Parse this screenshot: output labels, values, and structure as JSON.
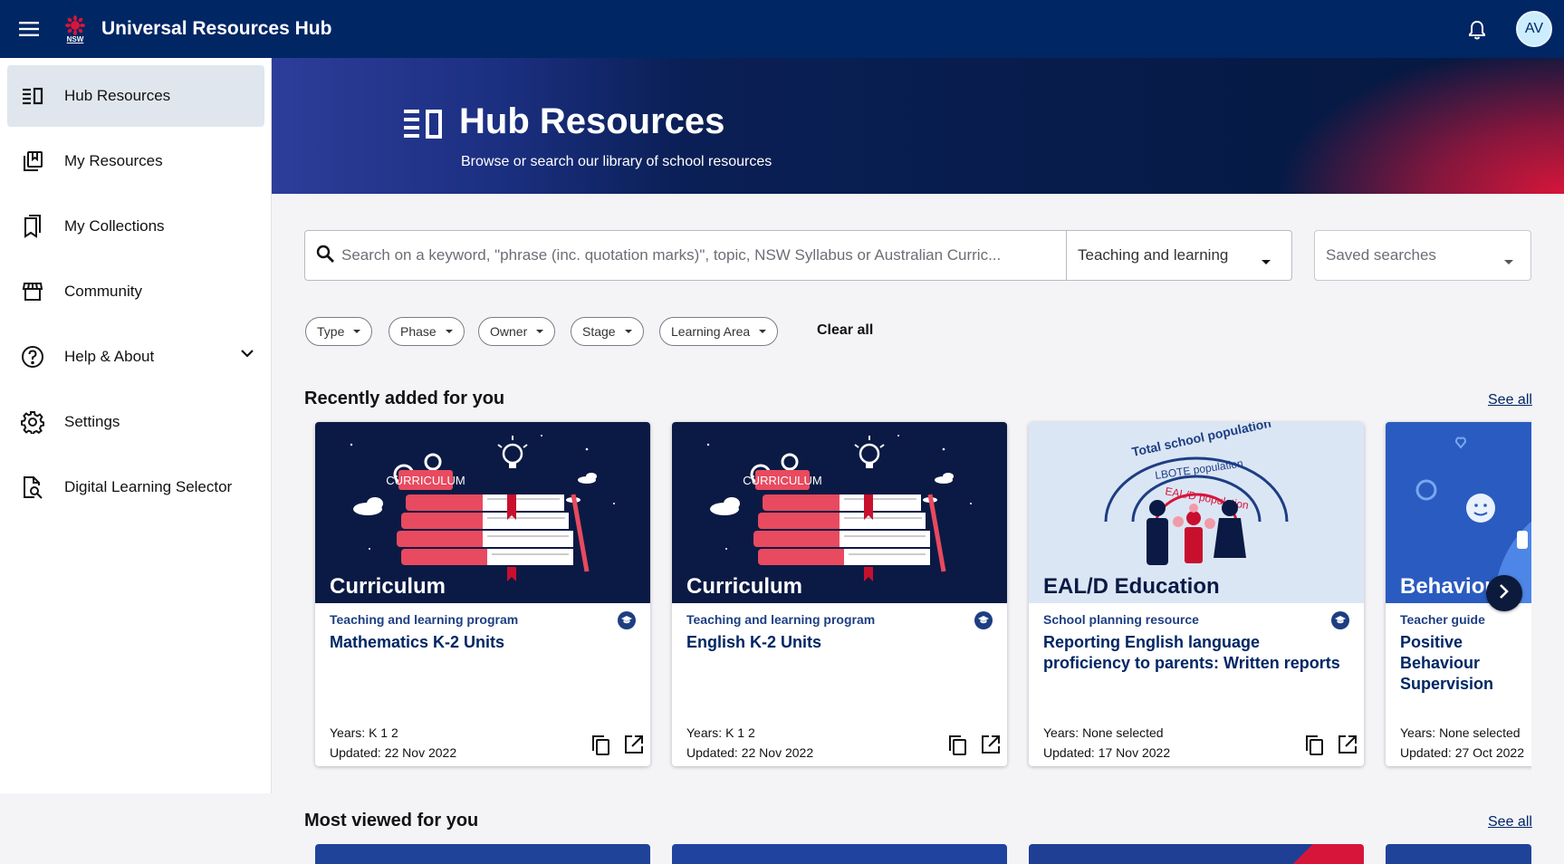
{
  "app": {
    "title": "Universal Resources Hub",
    "avatar_initials": "AV",
    "logo_text": "NSW"
  },
  "colors": {
    "primary": "#002664",
    "accent": "#d7153a",
    "card_type": "#1d3e82"
  },
  "sidebar": {
    "items": [
      {
        "label": "Hub Resources",
        "icon": "hub-resources-icon",
        "active": true
      },
      {
        "label": "My Resources",
        "icon": "my-resources-icon"
      },
      {
        "label": "My Collections",
        "icon": "collections-icon"
      },
      {
        "label": "Community",
        "icon": "community-icon"
      },
      {
        "label": "Help & About",
        "icon": "help-icon",
        "expandable": true
      },
      {
        "label": "Settings",
        "icon": "gear-icon"
      },
      {
        "label": "Digital Learning Selector",
        "icon": "search-document-icon"
      }
    ]
  },
  "hero": {
    "title": "Hub Resources",
    "subtitle": "Browse or search our library of school resources"
  },
  "search": {
    "placeholder": "Search on a keyword, \"phrase (inc. quotation marks)\", topic, NSW Syllabus or Australian Curric...",
    "category": "Teaching and learning",
    "saved_placeholder": "Saved searches"
  },
  "filters": [
    "Type",
    "Phase",
    "Owner",
    "Stage",
    "Learning Area"
  ],
  "clear_all": "Clear all",
  "sections": {
    "recent": {
      "title": "Recently added for you",
      "see_all": "See all"
    },
    "most_viewed": {
      "title": "Most viewed for you",
      "see_all": "See all"
    }
  },
  "cards": [
    {
      "thumb_label": "Curriculum",
      "thumb_text": "CURRICULUM",
      "type": "Teaching and learning program",
      "title": "Mathematics K-2 Units",
      "years": "Years: K 1 2",
      "updated": "Updated: 22 Nov 2022"
    },
    {
      "thumb_label": "Curriculum",
      "thumb_text": "CURRICULUM",
      "type": "Teaching and learning program",
      "title": "English K-2 Units",
      "years": "Years: K 1 2",
      "updated": "Updated: 22 Nov 2022"
    },
    {
      "thumb_label": "EAL/D Education",
      "arc_1": "Total school population",
      "arc_2": "LBOTE population",
      "arc_3": "EAL/D population",
      "type": "School planning resource",
      "title": "Reporting English language proficiency to parents: Written reports",
      "years": "Years: None selected",
      "updated": "Updated: 17 Nov 2022"
    },
    {
      "thumb_label": "Behaviour",
      "type": "Teacher guide",
      "title": "Positive Behaviour Supervision",
      "years": "Years: None selected",
      "updated": "Updated: 27 Oct 2022"
    }
  ]
}
